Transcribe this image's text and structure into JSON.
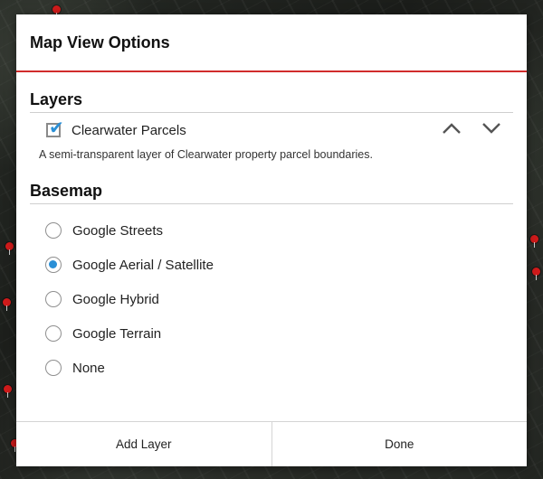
{
  "dialog": {
    "title": "Map View Options"
  },
  "layers": {
    "section_title": "Layers",
    "items": [
      {
        "name": "Clearwater Parcels",
        "checked": true,
        "description": "A semi-transparent layer of Clearwater property parcel boundaries.",
        "icons": [
          "chevron-up-icon",
          "chevron-down-icon"
        ]
      }
    ]
  },
  "basemap": {
    "section_title": "Basemap",
    "options": [
      {
        "label": "Google Streets",
        "selected": false
      },
      {
        "label": "Google Aerial / Satellite",
        "selected": true
      },
      {
        "label": "Google Hybrid",
        "selected": false
      },
      {
        "label": "Google Terrain",
        "selected": false
      },
      {
        "label": "None",
        "selected": false
      }
    ]
  },
  "footer": {
    "add_layer_label": "Add Layer",
    "done_label": "Done"
  },
  "colors": {
    "accent": "#d12b2b",
    "selection": "#2a8fd6"
  }
}
